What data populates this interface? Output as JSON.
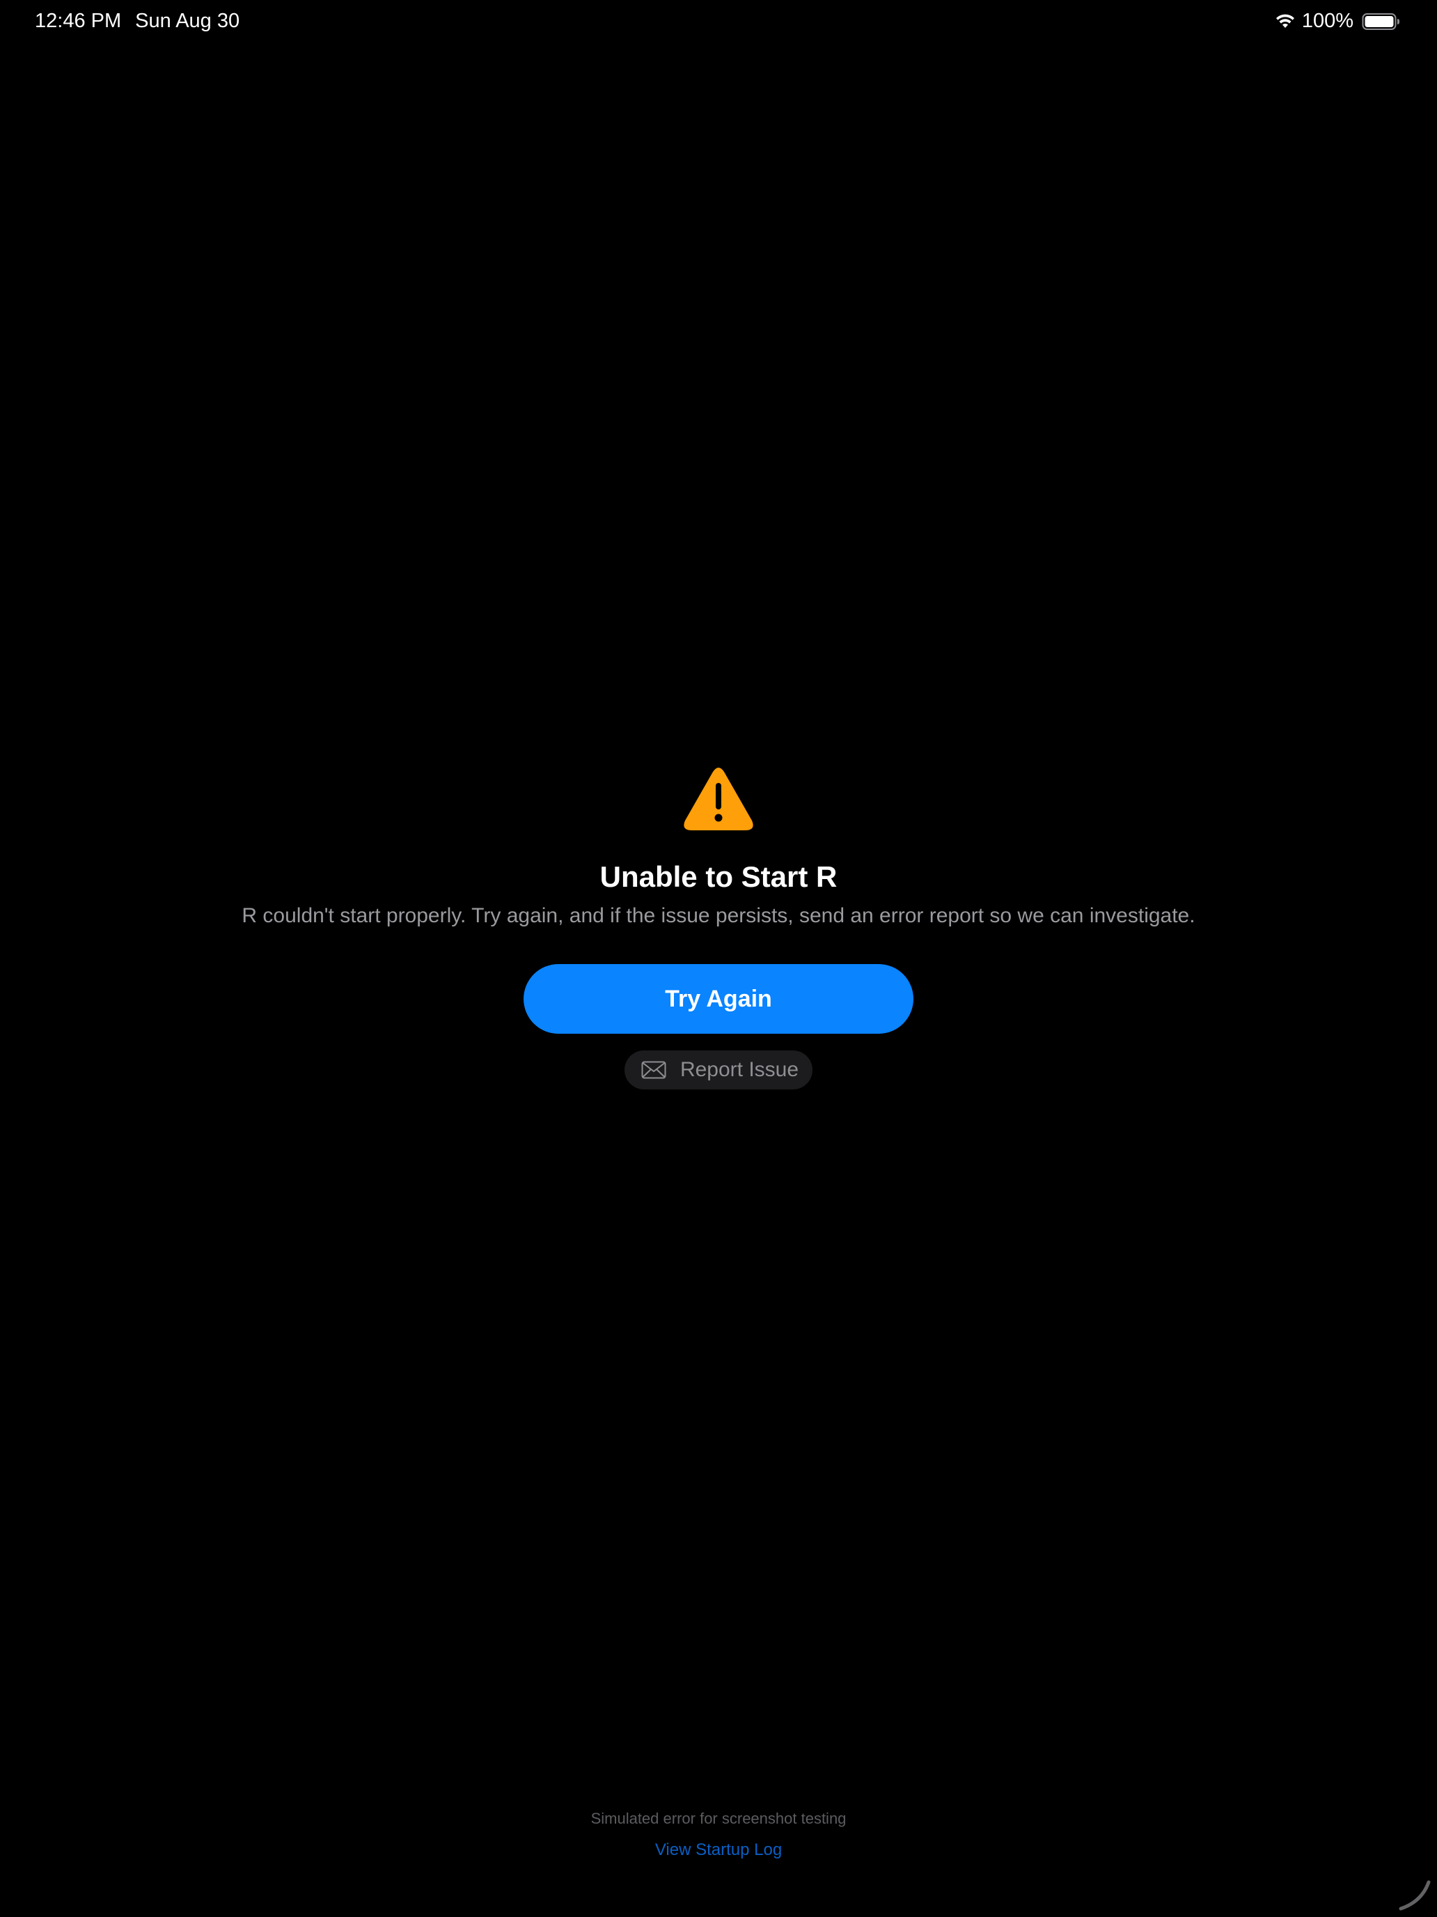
{
  "status_bar": {
    "time": "12:46 PM",
    "date": "Sun Aug 30",
    "battery_percent": "100%",
    "wifi_icon": "wifi-icon",
    "battery_icon": "battery-full-icon"
  },
  "error": {
    "icon": "warning-triangle-icon",
    "icon_color": "#ff9f0a",
    "title": "Unable to Start R",
    "message": "R couldn't start properly. Try again, and if the issue persists, send an error report so we can investigate."
  },
  "actions": {
    "try_again_label": "Try Again",
    "try_again_color": "#0a84ff",
    "report_issue_label": "Report Issue",
    "report_issue_icon": "envelope-icon"
  },
  "footer": {
    "note": "Simulated error for screenshot testing",
    "startup_log_link": "View Startup Log"
  }
}
